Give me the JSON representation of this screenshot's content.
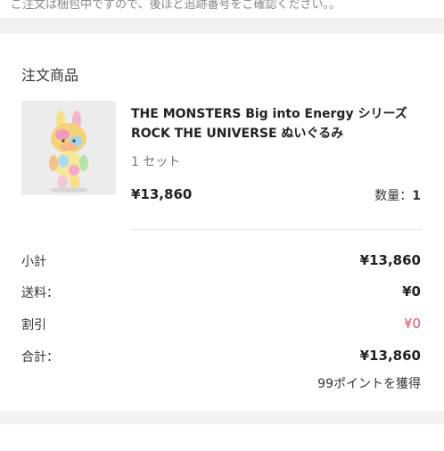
{
  "notice": {
    "text": "ご注文は梱包中ですので、後ほど追跡番号をご確認ください。。"
  },
  "order_items": {
    "title": "注文商品",
    "product": {
      "name": "THE MONSTERS Big into Energy シリーズ ROCK THE UNIVERSE ぬいぐるみ",
      "set_text": "1 セット",
      "price": "¥13,860",
      "quantity_label": "数量：",
      "quantity_value": "1"
    }
  },
  "summary": {
    "subtotal_label": "小計",
    "subtotal_value": "¥13,860",
    "shipping_label": "送料：",
    "shipping_value": "¥0",
    "discount_label": "割引",
    "discount_value": "¥0",
    "total_label": "合計：",
    "total_value": "¥13,860",
    "points_text": "99ポイントを獲得"
  },
  "colors": {
    "page_background": "#f2f2f2",
    "card_background": "#ffffff",
    "discount_value": "#e24c6c",
    "muted_text": "#777777"
  }
}
